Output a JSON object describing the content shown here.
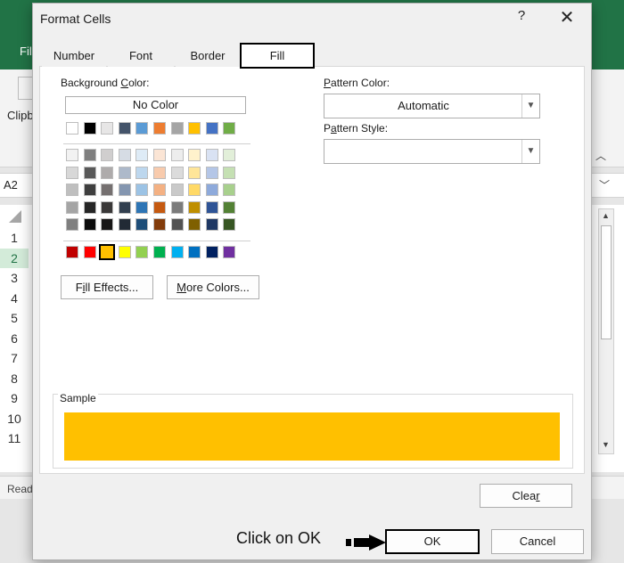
{
  "excel": {
    "file_tab": "Fil",
    "clipboard_label": "Clipb",
    "name_box": "A2",
    "row_headers": [
      "1",
      "2",
      "3",
      "4",
      "5",
      "6",
      "7",
      "8",
      "9",
      "10",
      "11"
    ],
    "status_text": "Read"
  },
  "dialog": {
    "title": "Format Cells",
    "help": "?",
    "close": "✕",
    "tabs": [
      {
        "label": "Number"
      },
      {
        "label": "Font"
      },
      {
        "label": "Border"
      },
      {
        "label": "Fill",
        "active": true
      }
    ],
    "background_color": {
      "label_pre": "Background ",
      "label_key": "C",
      "label_post": "olor:",
      "no_color": "No Color",
      "theme_top": [
        "#ffffff",
        "#000000",
        "#e7e6e6",
        "#44546a",
        "#5b9bd5",
        "#ed7d31",
        "#a5a5a5",
        "#ffc000",
        "#4472c4",
        "#70ad47"
      ],
      "theme_shades": [
        [
          "#f2f2f2",
          "#7f7f7f",
          "#d0cece",
          "#d6dce4",
          "#deebf6",
          "#fbe5d5",
          "#ededed",
          "#fff2cc",
          "#d9e2f3",
          "#e2efd9"
        ],
        [
          "#d8d8d8",
          "#595959",
          "#aeabab",
          "#adb9ca",
          "#bdd7ee",
          "#f8cbad",
          "#dbdbdb",
          "#fee599",
          "#b4c6e7",
          "#c5e0b3"
        ],
        [
          "#bfbfbf",
          "#3f3f3f",
          "#757070",
          "#8496b0",
          "#9cc3e5",
          "#f4b183",
          "#c9c9c9",
          "#ffd966",
          "#8eaadb",
          "#a8d08d"
        ],
        [
          "#a5a5a5",
          "#262626",
          "#3a3838",
          "#323f4f",
          "#2e75b5",
          "#c55a11",
          "#7b7b7b",
          "#bf8f00",
          "#2f5496",
          "#538135"
        ],
        [
          "#7f7f7f",
          "#0c0c0c",
          "#171616",
          "#222a35",
          "#1e4e79",
          "#833c0b",
          "#525252",
          "#7f6000",
          "#1f3864",
          "#375623"
        ]
      ],
      "standard": [
        "#c00000",
        "#ff0000",
        "#ffc000",
        "#ffff00",
        "#92d050",
        "#00b050",
        "#00b0f0",
        "#0070c0",
        "#002060",
        "#7030a0"
      ],
      "selected_index": 2,
      "fill_effects": {
        "pre": "F",
        "key": "i",
        "post": "ll Effects..."
      },
      "more_colors": {
        "pre": "",
        "key": "M",
        "post": "ore Colors..."
      }
    },
    "pattern_color": {
      "label_pre": "",
      "label_key": "P",
      "label_post": "attern Color:",
      "value": "Automatic"
    },
    "pattern_style": {
      "label_pre": "P",
      "label_key": "a",
      "label_post": "ttern Style:",
      "value": ""
    },
    "sample": {
      "label": "Sample",
      "color": "#ffc000"
    },
    "clear": {
      "pre": "Clea",
      "key": "r",
      "post": ""
    },
    "ok": "OK",
    "cancel": "Cancel"
  },
  "annotation": {
    "text": "Click on OK",
    "icon": "right-arrow-icon"
  },
  "colors": {
    "excel_green": "#217346",
    "selected_fill": "#ffc000"
  }
}
